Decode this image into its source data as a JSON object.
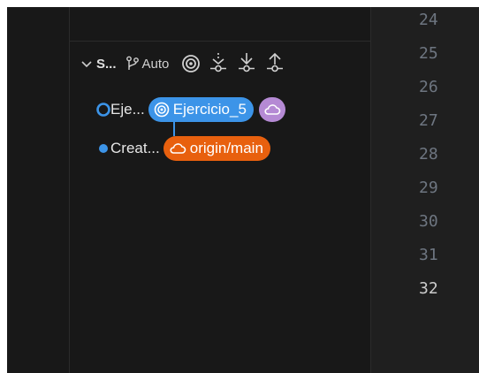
{
  "scm": {
    "title": "S...",
    "auto_label": "Auto"
  },
  "graph": {
    "commits": [
      {
        "message": "Eje...",
        "ref": "Ejercicio_5",
        "ref_kind": "branch",
        "remote_icon": "cloud-icon"
      },
      {
        "message": "Creat...",
        "ref": "origin/main",
        "ref_kind": "remote"
      }
    ]
  },
  "editor": {
    "line_numbers": [
      "24",
      "25",
      "26",
      "27",
      "28",
      "29",
      "30",
      "31",
      "32"
    ],
    "active_line": "32"
  },
  "colors": {
    "branch_badge": "#3c94e8",
    "remote_badge": "#e8600e",
    "cloud_badge": "#b58ad4",
    "graph_line": "#3c94e8"
  }
}
